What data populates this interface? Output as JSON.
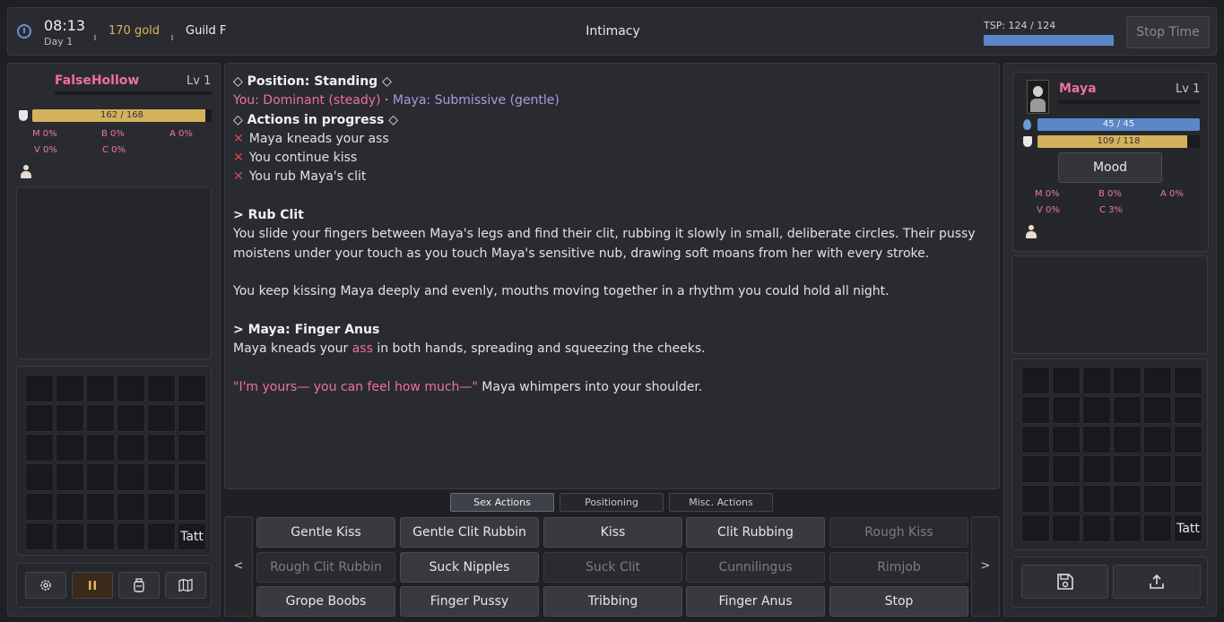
{
  "topbar": {
    "time": "08:13",
    "day": "Day 1",
    "gold": "170 gold",
    "guild": "Guild F",
    "title": "Intimacy",
    "tsp": "TSP: 124 / 124",
    "tsp_fraction": 1.0,
    "stop_time": "Stop Time"
  },
  "player": {
    "name": "FalseHollow",
    "level": "Lv 1",
    "hp": "162 / 168",
    "hp_fraction": 0.964,
    "stats": {
      "m": "M 0%",
      "b": "B 0%",
      "a": "A 0%",
      "v": "V 0%",
      "c": "C 0%"
    },
    "tatt": "Tatt"
  },
  "partner": {
    "name": "Maya",
    "level": "Lv 1",
    "mana": "45 / 45",
    "mana_fraction": 1.0,
    "hp": "109 / 118",
    "hp_fraction": 0.924,
    "mood": "Mood",
    "stats": {
      "m": "M 0%",
      "b": "B 0%",
      "a": "A 0%",
      "v": "V 0%",
      "c": "C 3%"
    },
    "tatt": "Tatt"
  },
  "log": {
    "position": "◇ Position: Standing ◇",
    "you_role": "You: Dominant (steady)",
    "sep": " · ",
    "maya_role": "Maya: Submissive (gentle)",
    "actions_header": "◇ Actions in progress ◇",
    "in_progress": [
      "Maya kneads your ass",
      "You continue kiss",
      "You rub Maya's clit"
    ],
    "h1": "> Rub Clit",
    "p1": "You slide your fingers between Maya's legs and find their clit, rubbing it slowly in small, deliberate circles. Their pussy moistens under your touch as you touch Maya's sensitive nub, drawing soft moans from her with every stroke.",
    "p2": "You keep kissing Maya deeply and evenly, mouths moving together in a rhythm you could hold all night.",
    "h2": "> Maya: Finger Anus",
    "p3a": "Maya kneads your ",
    "p3b": "ass",
    "p3c": " in both hands, spreading and squeezing the cheeks.",
    "quote": "\"I'm yours— you can feel how much—\"",
    "quote_tail": " Maya whimpers into your shoulder."
  },
  "tabs": [
    "Sex Actions",
    "Positioning",
    "Misc. Actions"
  ],
  "pager": {
    "prev": "<",
    "next": ">"
  },
  "actions": [
    [
      {
        "label": "Gentle Kiss",
        "enabled": true
      },
      {
        "label": "Gentle Clit Rubbin",
        "enabled": true
      },
      {
        "label": "Kiss",
        "enabled": true
      },
      {
        "label": "Clit Rubbing",
        "enabled": true
      },
      {
        "label": "Rough Kiss",
        "enabled": false
      }
    ],
    [
      {
        "label": "Rough Clit Rubbin",
        "enabled": false
      },
      {
        "label": "Suck Nipples",
        "enabled": true
      },
      {
        "label": "Suck Clit",
        "enabled": false
      },
      {
        "label": "Cunnilingus",
        "enabled": false
      },
      {
        "label": "Rimjob",
        "enabled": false
      }
    ],
    [
      {
        "label": "Grope Boobs",
        "enabled": true
      },
      {
        "label": "Finger Pussy",
        "enabled": true
      },
      {
        "label": "Tribbing",
        "enabled": true
      },
      {
        "label": "Finger Anus",
        "enabled": true
      },
      {
        "label": "Stop",
        "enabled": true
      }
    ]
  ],
  "colors": {
    "accent_pink": "#ee6fa6",
    "gold": "#d9b45a",
    "bar_blue": "#5b86c9",
    "bar_gold": "#d4b15b"
  }
}
